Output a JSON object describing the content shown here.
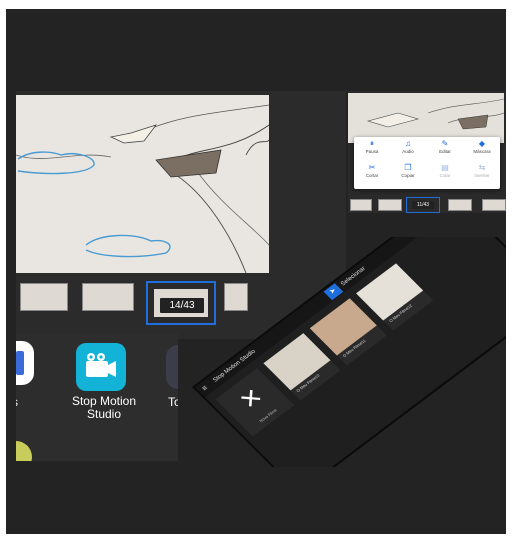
{
  "main_editor": {
    "frame_counter": "14/43"
  },
  "launcher": {
    "left_app_label": "s",
    "app_label": "Stop Motion Studio",
    "right_app_label": "To"
  },
  "right_editor": {
    "frame_counter": "11/43",
    "tools": [
      {
        "icon": "pause-icon",
        "glyph": "⏸",
        "label": "Pausa",
        "enabled": true
      },
      {
        "icon": "audio-icon",
        "glyph": "♫",
        "label": "Audio",
        "enabled": true
      },
      {
        "icon": "edit-icon",
        "glyph": "✎",
        "label": "Editar",
        "enabled": true
      },
      {
        "icon": "eraser-icon",
        "glyph": "◆",
        "label": "Máscara",
        "enabled": true
      },
      {
        "icon": "cut-icon",
        "glyph": "✂",
        "label": "Cortar",
        "enabled": true
      },
      {
        "icon": "copy-icon",
        "glyph": "❐",
        "label": "Copiar",
        "enabled": true
      },
      {
        "icon": "paste-icon",
        "glyph": "▤",
        "label": "Colar",
        "enabled": false
      },
      {
        "icon": "reverse-icon",
        "glyph": "⇆",
        "label": "Inverter",
        "enabled": false
      }
    ]
  },
  "project_list": {
    "menu_glyph": "≡",
    "title": "Stop Motion Studio",
    "select_glyph": "➤",
    "select_label": "Selecionar",
    "new_film_glyph": "✕",
    "new_film_label": "Novo Filme",
    "projects": [
      {
        "name": "O Meu Filme10",
        "subtitle": ""
      },
      {
        "name": "O Meu Filme11",
        "subtitle": ""
      },
      {
        "name": "O Meu Filme12",
        "subtitle": ""
      }
    ]
  },
  "colors": {
    "accent": "#1e6fdc",
    "app_icon": "#12b3d6",
    "background": "#232323"
  }
}
